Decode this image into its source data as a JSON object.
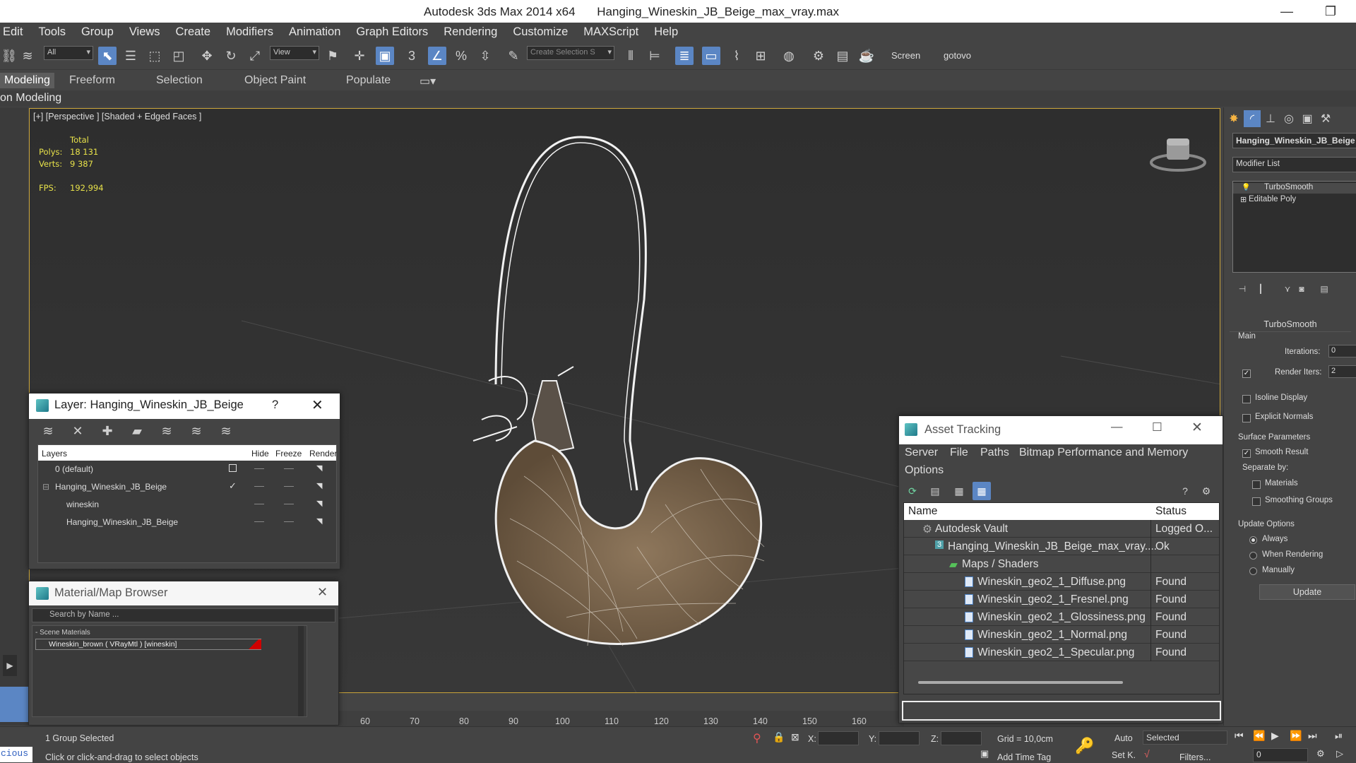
{
  "window": {
    "app_title": "Autodesk 3ds Max  2014 x64",
    "file_title": "Hanging_Wineskin_JB_Beige_max_vray.max"
  },
  "menu": [
    "Edit",
    "Tools",
    "Group",
    "Views",
    "Create",
    "Modifiers",
    "Animation",
    "Graph Editors",
    "Rendering",
    "Customize",
    "MAXScript",
    "Help"
  ],
  "toolbar": {
    "filter_value": "All",
    "ref_coord_value": "View",
    "selection_set_placeholder": "Create Selection S",
    "screen_label": "Screen",
    "gotovo_label": "gotovo",
    "snap_label": "3"
  },
  "ribbon": {
    "tabs": [
      "Modeling",
      "Freeform",
      "Selection",
      "Object Paint",
      "Populate"
    ],
    "subtitle": "on Modeling"
  },
  "viewport": {
    "label": "[+] [Perspective ] [Shaded + Edged Faces ]",
    "stats": {
      "total_label": "Total",
      "polys_label": "Polys:",
      "polys_value": "18 131",
      "verts_label": "Verts:",
      "verts_value": "9 387",
      "fps_label": "FPS:",
      "fps_value": "192,994"
    }
  },
  "ruler": [
    "60",
    "70",
    "80",
    "90",
    "100",
    "110",
    "120",
    "130",
    "140",
    "150",
    "160"
  ],
  "layer_dialog": {
    "title": "Layer: Hanging_Wineskin_JB_Beige",
    "help_label": "?",
    "columns": [
      "Layers",
      "Hide",
      "Freeze",
      "Render"
    ],
    "rows": [
      {
        "name": "0 (default)"
      },
      {
        "name": "Hanging_Wineskin_JB_Beige"
      },
      {
        "name": "wineskin"
      },
      {
        "name": "Hanging_Wineskin_JB_Beige"
      }
    ]
  },
  "material_browser": {
    "title": "Material/Map Browser",
    "search_placeholder": "Search by Name ...",
    "section": "- Scene Materials",
    "material": "Wineskin_brown ( VRayMtl ) [wineskin]"
  },
  "asset_tracking": {
    "title": "Asset Tracking",
    "menu": [
      "Server",
      "File",
      "Paths",
      "Bitmap Performance and Memory",
      "Options"
    ],
    "columns": [
      "Name",
      "Status"
    ],
    "rows": [
      {
        "name": "Autodesk Vault",
        "status": "Logged O..."
      },
      {
        "name": "Hanging_Wineskin_JB_Beige_max_vray....",
        "status": "Ok"
      },
      {
        "name": "Maps / Shaders",
        "status": ""
      },
      {
        "name": "Wineskin_geo2_1_Diffuse.png",
        "status": "Found"
      },
      {
        "name": "Wineskin_geo2_1_Fresnel.png",
        "status": "Found"
      },
      {
        "name": "Wineskin_geo2_1_Glossiness.png",
        "status": "Found"
      },
      {
        "name": "Wineskin_geo2_1_Normal.png",
        "status": "Found"
      },
      {
        "name": "Wineskin_geo2_1_Specular.png",
        "status": "Found"
      }
    ]
  },
  "command_panel": {
    "object_name": "Hanging_Wineskin_JB_Beige",
    "modifier_list": "Modifier List",
    "stack": [
      "TurboSmooth",
      "Editable Poly"
    ],
    "rollout_title": "TurboSmooth",
    "main_label": "Main",
    "iterations_label": "Iterations:",
    "iterations_value": "0",
    "render_iters_label": "Render Iters:",
    "render_iters_value": "2",
    "isoline_label": "Isoline Display",
    "explicit_label": "Explicit Normals",
    "surface_params_label": "Surface Parameters",
    "smooth_result_label": "Smooth Result",
    "separate_by_label": "Separate by:",
    "materials_label": "Materials",
    "smoothing_groups_label": "Smoothing Groups",
    "update_options_label": "Update Options",
    "always_label": "Always",
    "when_rendering_label": "When Rendering",
    "manually_label": "Manually",
    "update_button": "Update"
  },
  "statusbar": {
    "maxscript_text": "cious",
    "selection_status": "1 Group Selected",
    "prompt": "Click or click-and-drag to select objects",
    "x_label": "X:",
    "y_label": "Y:",
    "z_label": "Z:",
    "grid": "Grid = 10,0cm",
    "add_time_tag": "Add Time Tag",
    "auto_label": "Auto",
    "setk_label": "Set K.",
    "selected_value": "Selected",
    "filters_label": "Filters...",
    "frame_value": "0"
  },
  "colors": {
    "accent": "#5b86c4",
    "viewport_border": "#c9a43a",
    "stats_yellow": "#e8e24a",
    "wineskin": "#8a7258"
  }
}
